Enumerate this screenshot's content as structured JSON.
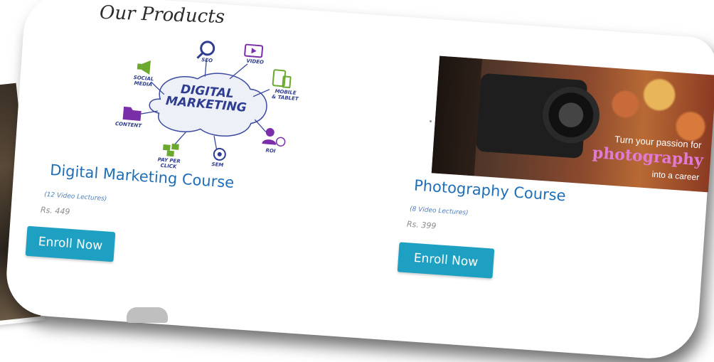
{
  "section": {
    "title": "Our Products"
  },
  "diagram": {
    "center_line1": "DIGITAL",
    "center_line2": "MARKETING",
    "labels": {
      "seo": "SEO",
      "video": "VIDEO",
      "mobile": "MOBILE\n& TABLET",
      "roi": "ROI",
      "sem": "SEM",
      "ppc": "PAY PER\nCLICK",
      "content": "CONTENT",
      "social": "SOCIAL\nMEDIA"
    }
  },
  "courses": [
    {
      "title": "Digital Marketing Course",
      "lectures": "(12 Video Lectures)",
      "price": "Rs. 449",
      "button": "Enroll Now"
    },
    {
      "title": "Photography Course",
      "lectures": "(8 Video Lectures)",
      "price": "Rs. 399",
      "button": "Enroll Now"
    }
  ],
  "banner": {
    "line1": "Turn your passion for",
    "line2": "photography",
    "line3": "into a career"
  },
  "colors": {
    "accent": "#1ea0c3",
    "title_blue": "#1f6fb8",
    "diagram_navy": "#2e3d8f",
    "diagram_green": "#6aa82e",
    "diagram_purple": "#7a2ea8"
  }
}
